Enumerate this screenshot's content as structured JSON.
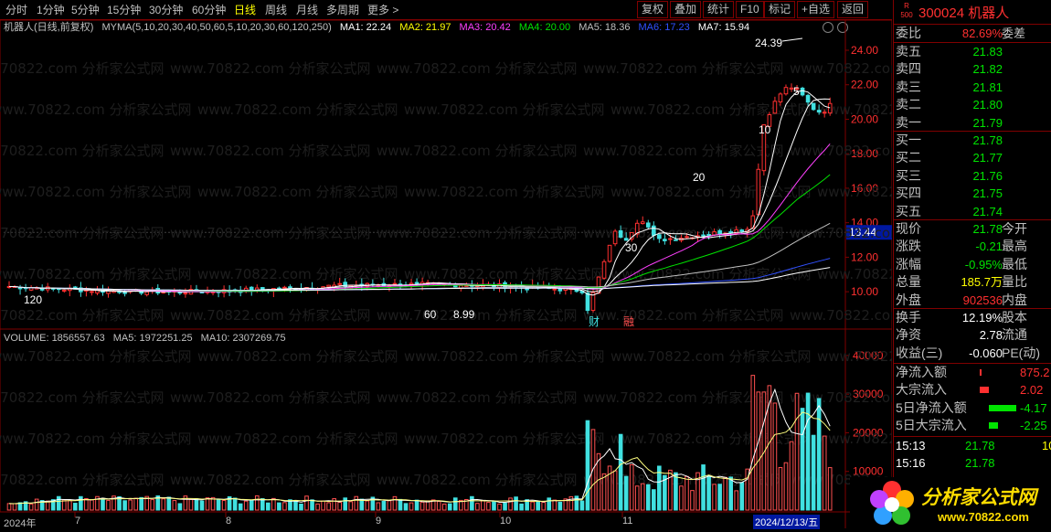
{
  "toolbar": {
    "periods": [
      "分时",
      "1分钟",
      "5分钟",
      "15分钟",
      "30分钟",
      "60分钟",
      "日线",
      "周线",
      "月线",
      "多周期",
      "更多 >"
    ],
    "selected": "日线",
    "right_buttons": [
      "复权",
      "叠加",
      "统计",
      "F10",
      "标记",
      "+自选",
      "返回"
    ]
  },
  "chart_title": {
    "stock": "机器人(日线,前复权)",
    "indicator": "MYMA(5,10,20,30,40,50,60,5,10,20,30,60,120,250)",
    "ma1": "MA1: 22.24",
    "ma2": "MA2: 21.97",
    "ma3": "MA3: 20.42",
    "ma4": "MA4: 20.00",
    "ma5": "MA5: 18.36",
    "ma6": "MA6: 17.23",
    "ma7": "MA7: 15.94"
  },
  "volume_title": {
    "vol": "VOLUME: 1856557.63",
    "ma5": "MA5: 1972251.25",
    "ma10": "MA10: 2307269.75"
  },
  "annotations": {
    "high": "24.39",
    "low": "8.99",
    "crosshair_price": "13.44",
    "ma_labels": [
      "5",
      "10",
      "20",
      "30",
      "60",
      "120"
    ],
    "markers": [
      "财",
      "融"
    ]
  },
  "x_axis": {
    "labels": [
      "2024年",
      "7",
      "8",
      "9",
      "10",
      "11"
    ],
    "current_date": "2024/12/13/五"
  },
  "watermark": "www.70822.com 分析家公式网",
  "chart_data": {
    "type": "candlestick",
    "price_axis": {
      "ticks": [
        10.0,
        12.0,
        14.0,
        16.0,
        18.0,
        20.0,
        22.0,
        24.0
      ]
    },
    "volume_axis": {
      "ticks": [
        10000,
        20000,
        30000,
        40000
      ]
    },
    "series": [
      {
        "name": "MA1",
        "value": 22.24
      },
      {
        "name": "MA2",
        "value": 21.97
      },
      {
        "name": "MA3",
        "value": 20.42
      },
      {
        "name": "MA4",
        "value": 20.0
      },
      {
        "name": "MA5",
        "value": 18.36
      },
      {
        "name": "MA6",
        "value": 17.23
      },
      {
        "name": "MA7",
        "value": 15.94
      }
    ],
    "high": 24.39,
    "low": 8.99
  },
  "quote": {
    "badge": "R 500",
    "code": "300024",
    "name": "机器人",
    "weibi_label": "委比",
    "weibi_value": "82.69%",
    "weicha_label": "委差",
    "sell": [
      {
        "label": "卖五",
        "price": "21.83"
      },
      {
        "label": "卖四",
        "price": "21.82"
      },
      {
        "label": "卖三",
        "price": "21.81"
      },
      {
        "label": "卖二",
        "price": "21.80"
      },
      {
        "label": "卖一",
        "price": "21.79"
      }
    ],
    "buy": [
      {
        "label": "买一",
        "price": "21.78"
      },
      {
        "label": "买二",
        "price": "21.77"
      },
      {
        "label": "买三",
        "price": "21.76"
      },
      {
        "label": "买四",
        "price": "21.75"
      },
      {
        "label": "买五",
        "price": "21.74"
      }
    ],
    "stats": [
      {
        "label": "现价",
        "value": "21.78",
        "right": "今开"
      },
      {
        "label": "涨跌",
        "value": "-0.21",
        "right": "最高"
      },
      {
        "label": "涨幅",
        "value": "-0.95%",
        "right": "最低"
      },
      {
        "label": "总量",
        "value": "185.7万",
        "right": "量比"
      },
      {
        "label": "外盘",
        "value": "902536",
        "right": "内盘"
      }
    ],
    "stats2": [
      {
        "label": "换手",
        "value": "12.19%",
        "right": "股本"
      },
      {
        "label": "净资",
        "value": "2.78",
        "right": "流通"
      },
      {
        "label": "收益(三)",
        "value": "-0.060",
        "right": "PE(动)"
      }
    ],
    "flows": [
      {
        "label": "净流入额",
        "value": "875.2"
      },
      {
        "label": "大宗流入",
        "value": "2.02"
      },
      {
        "label": "5日净流入额",
        "value": "-4.17"
      },
      {
        "label": "5日大宗流入",
        "value": "-2.25"
      }
    ],
    "ticks": [
      {
        "time": "15:13",
        "price": "21.78",
        "vol": "10"
      },
      {
        "time": "15:16",
        "price": "21.78",
        "vol": ""
      },
      {
        "time": "15:16",
        "price": "21.78",
        "vol": ""
      }
    ]
  },
  "logo": {
    "text": "分析家公式网",
    "url": "www.70822.com"
  }
}
